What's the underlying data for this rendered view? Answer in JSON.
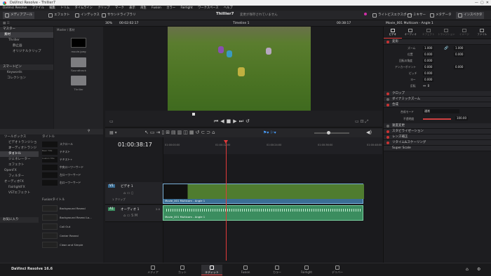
{
  "window_title": "DaVinci Resolve - Thillier7",
  "menu": [
    "DaVinci Resolve",
    "ファイル",
    "編集",
    "トリム",
    "タイムライン",
    "クリップ",
    "マーク",
    "表示",
    "再生",
    "Fusion",
    "カラー",
    "Fairlight",
    "ワークスペース",
    "ヘルプ"
  ],
  "toolbar": {
    "media_pool": "メディアプール",
    "effects": "エフェクト",
    "index": "インデックス",
    "sound_library": "サウンドライブラリ",
    "project_name": "Thillier7",
    "status": "変更が保存されていません",
    "render_export": "ライトビスエクスポート",
    "mixer": "ミキサー",
    "metadata": "メタデータ",
    "inspector": "インスペクタ"
  },
  "subbar": {
    "zoom": "30%",
    "timecode": "00:02:02:17",
    "timeline": "Timeline 1",
    "tc2": "00:38:17",
    "clip_name": "Movie_001 Multicam - Angle 1"
  },
  "media": {
    "left_header": "マスター",
    "left_items": [
      "素材",
      "Thriller",
      "静止画",
      "オリジナルクリップ"
    ],
    "smart_header": "スマートビン",
    "smart_items": [
      "Keywords",
      "コレクション"
    ],
    "breadcrumb": "Master / 素材",
    "items": [
      "movie.jpeg",
      "Soundtrack",
      "Thriller"
    ]
  },
  "effects": {
    "tree": [
      "ツールボックス",
      "ビデオトランジション",
      "オーディオトランジション",
      "タイトル",
      "ジェネレーター",
      "エフェクト",
      "OpenFX",
      "フィルター",
      "オーディオFX",
      "FairlightFX",
      "VSTエフェクト"
    ],
    "favorites": "お気に入り",
    "titles_header": "タイトル",
    "titles": [
      "スクロール",
      "テキスト",
      "テキスト+",
      "中央ローワーサード",
      "左ローワーサード",
      "右ローワーサード"
    ],
    "title_thumbs": [
      "",
      "Basic Title",
      "Custom Title",
      "",
      "",
      ""
    ],
    "fusion_header": "Fusionタイトル",
    "fusion": [
      "Background Reveal",
      "Background Reveal Lo...",
      "Call Out",
      "Center Reveal",
      "Clean and Simple"
    ]
  },
  "timeline": {
    "tc": "01:00:38:17",
    "ruler": [
      "01:00:00:00",
      "01:00:12:00",
      "01:00:24:00",
      "01:00:36:00",
      "01:00:48:00"
    ],
    "v1": "V1",
    "v1_name": "ビデオ 1",
    "v1_sub": "1 クリップ",
    "a1": "A1",
    "a1_name": "オーディオ 1",
    "a1_level": "2.0",
    "video_clip": "Movie_001 Multicam - Angle 1",
    "audio_clip": "Movie_001 Multicam - Angle 1"
  },
  "inspector": {
    "clip": "Movie_001 Multicam - Angle 1",
    "tabs": [
      "ビデオ",
      "オーディオ",
      "エフェクト",
      "トランジション",
      "イメージ",
      "ファイル"
    ],
    "transform": "変形",
    "rows": [
      {
        "label": "ズーム",
        "x": "1.000",
        "y": "1.000"
      },
      {
        "label": "位置",
        "x": "0.000",
        "y": "0.000"
      },
      {
        "label": "回転の角度",
        "x": "0.000",
        "y": ""
      },
      {
        "label": "アンカーポイント",
        "x": "0.000",
        "y": "0.000"
      },
      {
        "label": "ピッチ",
        "x": "0.000",
        "y": ""
      },
      {
        "label": "ヨー",
        "x": "0.000",
        "y": ""
      },
      {
        "label": "反転",
        "x": "",
        "y": ""
      }
    ],
    "sections": [
      "クロップ",
      "ダイナミックズーム",
      "合成"
    ],
    "composite_mode_label": "合成モード",
    "composite_mode": "通常",
    "opacity_label": "不透明度",
    "opacity": "100.00",
    "more": [
      "速度変更",
      "スタビライゼーション",
      "レンズ補正",
      "リタイム&スケーリング",
      "Super Scale"
    ]
  },
  "pages": [
    "メディア",
    "カット",
    "エディット",
    "Fusion",
    "カラー",
    "Fairlight",
    "デリバー"
  ],
  "app_version": "DaVinci Resolve 16.6"
}
